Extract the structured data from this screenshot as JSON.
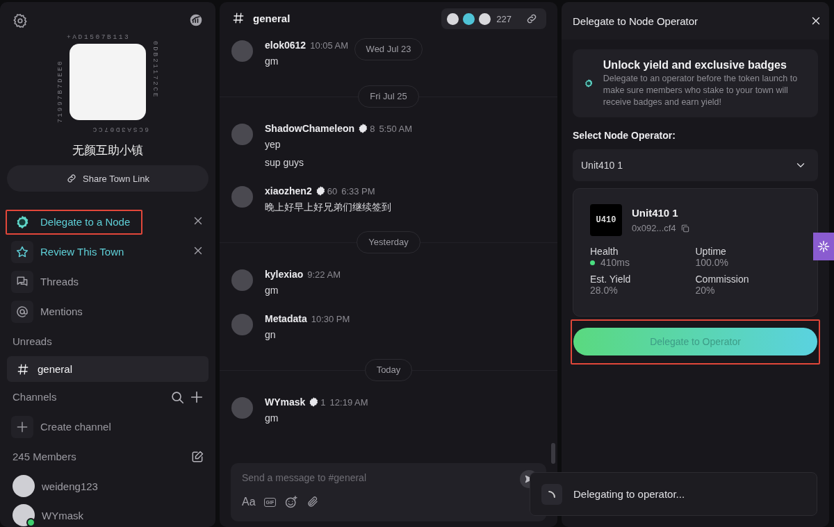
{
  "sidebar": {
    "address_ring": [
      "+AD1507B113",
      "0DB21172CE",
      "6CSA3D07CC",
      "71997B7DEE0"
    ],
    "town_name": "无颜互助小镇",
    "share_button": "Share Town Link",
    "nav_items": [
      {
        "kind": "delegate",
        "label": "Delegate to a Node",
        "highlighted": true,
        "dismissible": true
      },
      {
        "kind": "review",
        "label": "Review This Town",
        "highlighted": false,
        "dismissible": true
      },
      {
        "kind": "threads",
        "label": "Threads",
        "highlighted": false,
        "dismissible": false
      },
      {
        "kind": "mentions",
        "label": "Mentions",
        "highlighted": false,
        "dismissible": false
      }
    ],
    "unreads": {
      "title": "Unreads",
      "channels": [
        {
          "name": "general",
          "selected": true
        }
      ]
    },
    "channels": {
      "title": "Channels",
      "create_label": "Create channel"
    },
    "members": {
      "title": "245 Members",
      "list": [
        {
          "name": "weideng123",
          "online": false
        },
        {
          "name": "WYmask",
          "online": true
        }
      ]
    }
  },
  "chat": {
    "channel": "general",
    "member_count": "227",
    "sticky_date": "Wed Jul 23",
    "items": [
      {
        "kind": "message",
        "author": "elok0612",
        "time": "10:05 AM",
        "lines": [
          "gm"
        ]
      },
      {
        "kind": "date",
        "label": "Fri Jul 25"
      },
      {
        "kind": "message",
        "author": "ShadowChameleon",
        "badge": "8",
        "time": "5:50 AM",
        "lines": [
          "yep",
          "sup guys"
        ]
      },
      {
        "kind": "message",
        "author": "xiaozhen2",
        "badge": "60",
        "time": "6:33 PM",
        "lines": [
          "晚上好早上好兄弟们继续签到"
        ]
      },
      {
        "kind": "date",
        "label": "Yesterday"
      },
      {
        "kind": "message",
        "author": "kylexiao",
        "time": "9:22 AM",
        "lines": [
          "gm"
        ]
      },
      {
        "kind": "message",
        "author": "Metadata",
        "time": "10:30 PM",
        "lines": [
          "gn"
        ]
      },
      {
        "kind": "date",
        "label": "Today"
      },
      {
        "kind": "message",
        "author": "WYmask",
        "badge": "1",
        "time": "12:19 AM",
        "lines": [
          "gm"
        ]
      }
    ],
    "composer": {
      "placeholder": "Send a message to #general",
      "format_label": "Aa",
      "gif_label": "GIF"
    }
  },
  "panel": {
    "title": "Delegate to Node Operator",
    "promo": {
      "title": "Unlock yield and exclusive badges",
      "text": "Delegate to an operator before the token launch to make sure members who stake to your town will receive badges and earn yield!"
    },
    "select_label": "Select Node Operator:",
    "selected_operator": "Unit410 1",
    "operator": {
      "logo": "U410",
      "name": "Unit410 1",
      "address": "0x092...cf4",
      "stats": [
        {
          "kind": "health",
          "label": "Health",
          "value": "410ms"
        },
        {
          "kind": "plain",
          "label": "Uptime",
          "value": "100.0%"
        },
        {
          "kind": "plain",
          "label": "Est. Yield",
          "value": "28.0%"
        },
        {
          "kind": "plain",
          "label": "Commission",
          "value": "20%"
        }
      ]
    },
    "button": {
      "label": "Delegate to Operator",
      "highlighted": true
    }
  },
  "toast": {
    "text": "Delegating to operator..."
  }
}
